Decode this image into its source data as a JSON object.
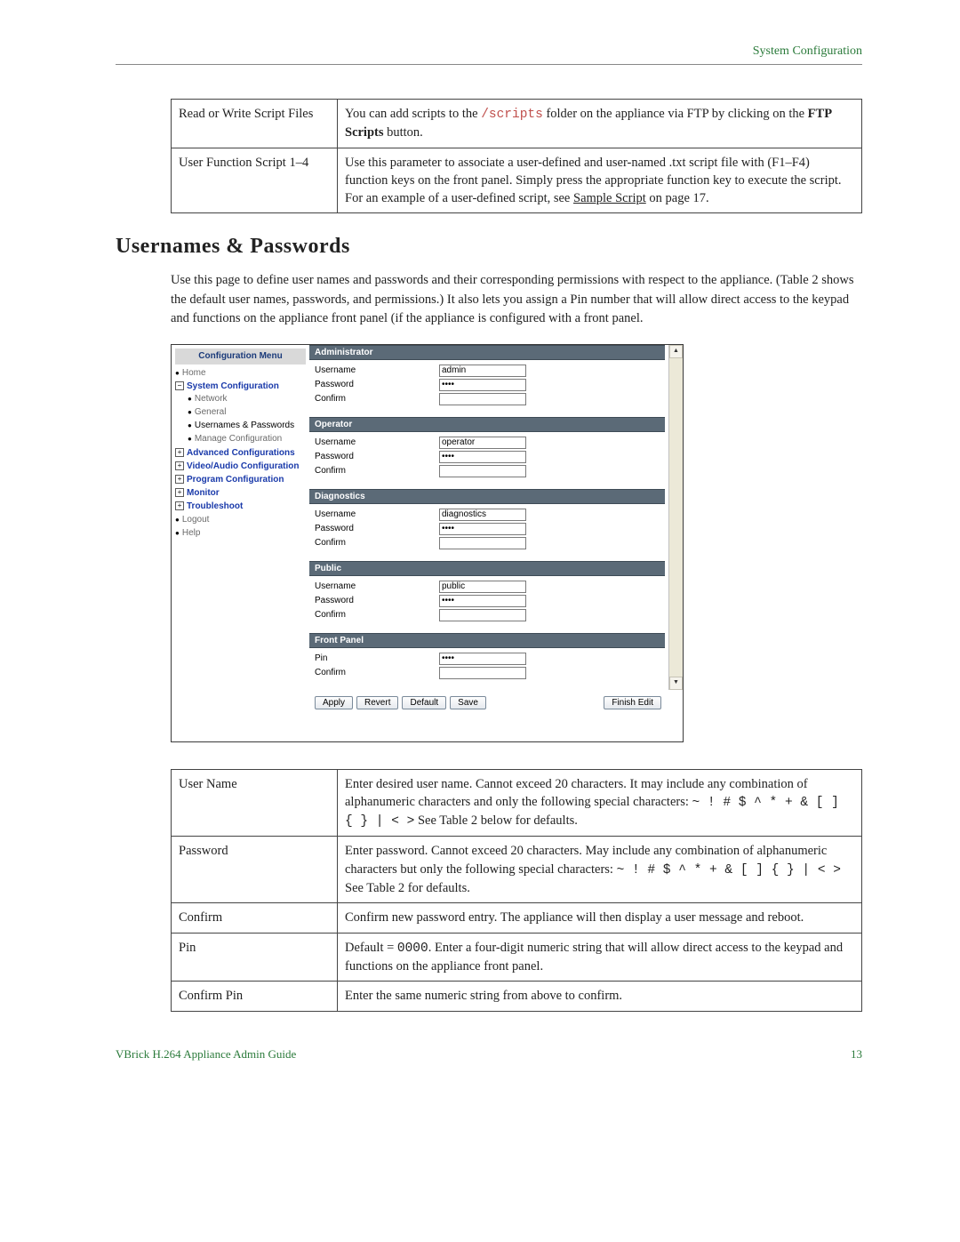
{
  "header": {
    "section": "System Configuration"
  },
  "table_top": {
    "rows": [
      {
        "label": "Read or Write Script Files",
        "desc_pre": "You can add scripts to the ",
        "code": "/scripts",
        "desc_mid": " folder on the appliance via FTP by clicking on the ",
        "bold": "FTP Scripts",
        "desc_post": " button."
      },
      {
        "label": "User Function Script 1–4",
        "desc_pre": "Use this parameter to associate a user-defined and user-named .txt script file with (F1–F4) function keys on the front panel. Simply press the appropriate function key to execute the script. For an example of a user-defined script, see ",
        "link": "Sample Script",
        "desc_post": " on page 17."
      }
    ]
  },
  "section_title": "Usernames & Passwords",
  "intro": "Use this page to define user names and passwords and their corresponding permissions with respect to the appliance. (Table 2 shows the default user names, passwords, and permissions.) It also lets you assign a Pin number that will allow direct access to the keypad and functions on the appliance front panel (if the appliance is configured with a front panel.",
  "app": {
    "sidebar_title": "Configuration Menu",
    "tree": {
      "home": "Home",
      "system_config": "System Configuration",
      "network": "Network",
      "general": "General",
      "usernames": "Usernames & Passwords",
      "manage": "Manage Configuration",
      "advanced": "Advanced Configurations",
      "video_audio": "Video/Audio Configuration",
      "program": "Program Configuration",
      "monitor": "Monitor",
      "troubleshoot": "Troubleshoot",
      "logout": "Logout",
      "help": "Help"
    },
    "sections": [
      {
        "title": "Administrator",
        "fields": [
          {
            "label": "Username",
            "value": "admin",
            "type": "text"
          },
          {
            "label": "Password",
            "value": "••••",
            "type": "password"
          },
          {
            "label": "Confirm",
            "value": "",
            "type": "password"
          }
        ]
      },
      {
        "title": "Operator",
        "fields": [
          {
            "label": "Username",
            "value": "operator",
            "type": "text"
          },
          {
            "label": "Password",
            "value": "••••",
            "type": "password"
          },
          {
            "label": "Confirm",
            "value": "",
            "type": "password"
          }
        ]
      },
      {
        "title": "Diagnostics",
        "fields": [
          {
            "label": "Username",
            "value": "diagnostics",
            "type": "text"
          },
          {
            "label": "Password",
            "value": "••••",
            "type": "password"
          },
          {
            "label": "Confirm",
            "value": "",
            "type": "password"
          }
        ]
      },
      {
        "title": "Public",
        "fields": [
          {
            "label": "Username",
            "value": "public",
            "type": "text"
          },
          {
            "label": "Password",
            "value": "••••",
            "type": "password"
          },
          {
            "label": "Confirm",
            "value": "",
            "type": "password"
          }
        ]
      },
      {
        "title": "Front Panel",
        "fields": [
          {
            "label": "Pin",
            "value": "••••",
            "type": "password"
          },
          {
            "label": "Confirm",
            "value": "",
            "type": "password"
          }
        ]
      }
    ],
    "buttons": {
      "apply": "Apply",
      "revert": "Revert",
      "default": "Default",
      "save": "Save",
      "finish": "Finish Edit"
    }
  },
  "table_bottom": {
    "rows": [
      {
        "label": "User Name",
        "desc_pre": "Enter desired user name. Cannot exceed 20 characters. It may include any combination of alphanumeric characters and only the following special characters: ",
        "code": "~ ! # $ ^ * + & [ ] { } | < >",
        "desc_post": " See Table 2 below for defaults."
      },
      {
        "label": "Password",
        "desc_pre": "Enter password. Cannot exceed 20 characters. May include any combination of alphanumeric characters but only the following special characters: ",
        "code": "~ ! # $ ^ * + & [ ] { } | < >",
        "desc_post": " See Table 2 for defaults."
      },
      {
        "label": "Confirm",
        "desc_pre": "Confirm new password entry. The appliance will then display a user message and reboot.",
        "code": "",
        "desc_post": ""
      },
      {
        "label": "Pin",
        "desc_pre": "Default = ",
        "code": "0000",
        "desc_post": ". Enter a four-digit numeric string that will allow direct access to the keypad and functions on the appliance front panel."
      },
      {
        "label": "Confirm Pin",
        "desc_pre": "Enter the same numeric string from above to confirm.",
        "code": "",
        "desc_post": ""
      }
    ]
  },
  "footer": {
    "guide": "VBrick H.264 Appliance Admin Guide",
    "page": "13"
  }
}
